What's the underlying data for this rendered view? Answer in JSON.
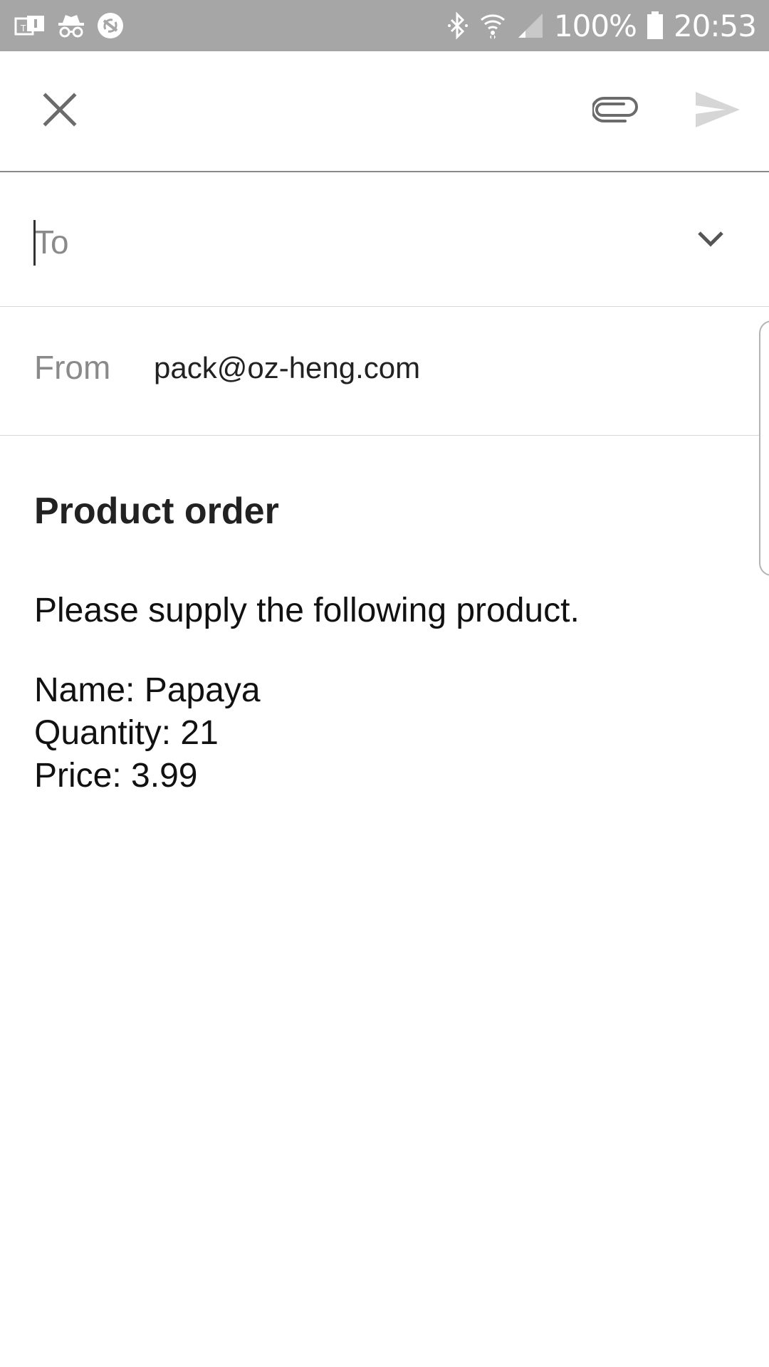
{
  "status_bar": {
    "battery_text": "100%",
    "time": "20:53",
    "left_icons": [
      "notification-box-icon",
      "incognito-icon",
      "no-sync-icon"
    ],
    "right_icons": [
      "bluetooth-icon",
      "wifi-icon",
      "cell-signal-icon",
      "battery-icon"
    ]
  },
  "toolbar": {
    "close_icon": "close-icon",
    "attach_icon": "paperclip-icon",
    "send_icon": "send-icon"
  },
  "compose": {
    "to_placeholder": "To",
    "from_label": "From",
    "from_value": "pack@oz-heng.com",
    "subject": "Product order",
    "body_lines": [
      "Please supply the following product.",
      "Name: Papaya",
      "Quantity: 21",
      "Price: 3.99"
    ]
  },
  "colors": {
    "status_bar_bg": "#a6a6a6",
    "icon_gray": "#6b6b6b",
    "send_disabled": "#d6d6d6",
    "label_gray": "#8a8a8a"
  }
}
